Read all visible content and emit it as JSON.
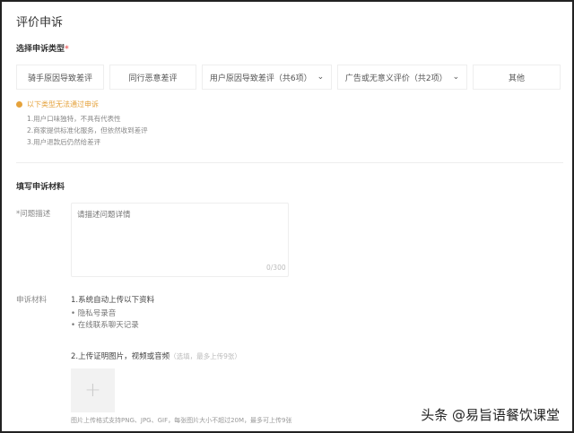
{
  "page_title": "评价申诉",
  "type_section": {
    "label": "选择申诉类型",
    "required": "*",
    "options": [
      {
        "label": "骑手原因导致差评",
        "dropdown": false
      },
      {
        "label": "同行恶意差评",
        "dropdown": false
      },
      {
        "label": "用户原因导致差评（共6项）",
        "dropdown": true
      },
      {
        "label": "广告或无意义评价（共2项）",
        "dropdown": true
      },
      {
        "label": "其他",
        "dropdown": false
      }
    ],
    "warning": "以下类型无法通过申诉",
    "rules": [
      "1.用户口味独特，不具有代表性",
      "2.商家提供标准化服务，但依然收到差评",
      "3.用户退款后仍然给差评"
    ]
  },
  "material_section": {
    "label": "填写申诉材料",
    "description_label": "*问题描述",
    "description_placeholder": "请描述问题详情",
    "description_count": "0/300",
    "materials_label": "申诉材料",
    "auto_title": "1.系统自动上传以下资料",
    "auto_items": [
      "隐私号录音",
      "在线联系聊天记录"
    ],
    "upload_title": "2.上传证明图片，视频或音频",
    "upload_note": "（选填，最多上传9张）",
    "upload_plus": "+",
    "upload_hint": "图片上传格式支持PNG、JPG、GIF，每张图片大小不超过20M，最多可上传9张"
  },
  "watermark": "头条 @易旨语餐饮课堂"
}
